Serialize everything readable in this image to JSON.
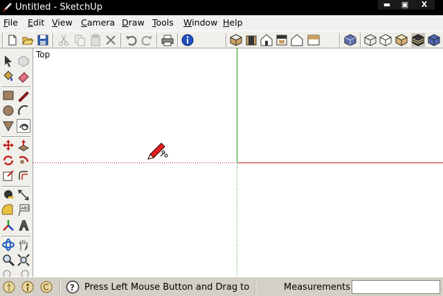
{
  "window": {
    "title": "Untitled - SketchUp",
    "controls": {
      "minimize": "▬",
      "maximize": "▣",
      "close": "X"
    }
  },
  "menubar": [
    {
      "accel": "F",
      "rest": "ile"
    },
    {
      "accel": "E",
      "rest": "dit"
    },
    {
      "accel": "V",
      "rest": "iew"
    },
    {
      "accel": "C",
      "rest": "amera"
    },
    {
      "accel": "D",
      "rest": "raw"
    },
    {
      "accel": "T",
      "rest": "ools"
    },
    {
      "accel": "W",
      "rest": "indow"
    },
    {
      "accel": "H",
      "rest": "elp"
    }
  ],
  "toolbar_icons": [
    "new-file-icon",
    "open-icon",
    "save-icon",
    "cut-icon",
    "copy-icon",
    "paste-icon",
    "erase-icon",
    "undo-icon",
    "redo-icon",
    "print-icon",
    "model-info-icon",
    "iso-view-icon",
    "top-view-icon",
    "front-view-icon",
    "right-view-icon",
    "back-view-icon",
    "left-view-icon",
    "xray-icon",
    "wireframe-icon",
    "hidden-line-icon",
    "shaded-icon",
    "shaded-textures-icon",
    "monochrome-icon"
  ],
  "left_tools": [
    "select-icon",
    "make-component-icon",
    "paint-bucket-icon",
    "eraser-icon",
    "rectangle-icon",
    "line-icon",
    "circle-icon",
    "arc-icon",
    "polygon-icon",
    "freehand-icon",
    "move-icon",
    "push-pull-icon",
    "rotate-icon",
    "follow-me-icon",
    "scale-icon",
    "offset-icon",
    "tape-measure-icon",
    "dimension-icon",
    "protractor-icon",
    "text-icon",
    "axes-icon",
    "3d-text-icon",
    "orbit-icon",
    "pan-icon",
    "zoom-icon",
    "zoom-extents-icon"
  ],
  "viewport": {
    "view_name": "Top",
    "colors": {
      "green_axis": "#1a9a1a",
      "red_axis": "#b02020"
    }
  },
  "statusbar": {
    "hint": "Press Left Mouse Button and Drag to D",
    "measurements_label": "Measurements",
    "measurements_value": ""
  }
}
